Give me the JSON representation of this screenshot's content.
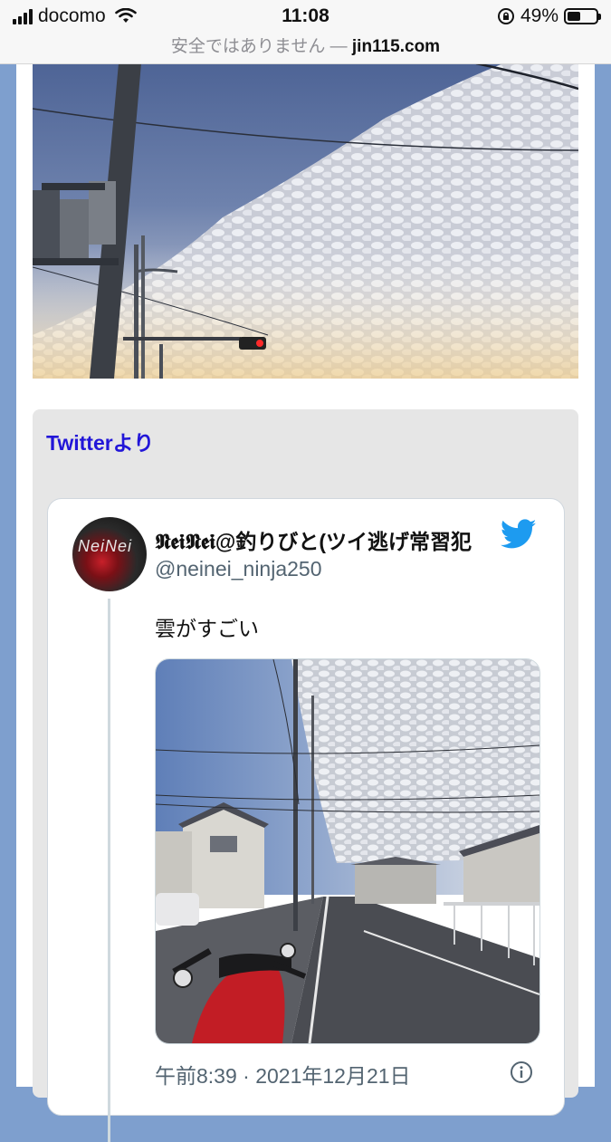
{
  "status_bar": {
    "carrier": "docomo",
    "time": "11:08",
    "battery_percent": "49%",
    "battery_level": 0.49,
    "icons": [
      "signal-bars-icon",
      "wifi-icon",
      "rotation-lock-icon",
      "battery-icon"
    ]
  },
  "browser": {
    "security_warning": "安全ではありません —",
    "host": "jin115.com"
  },
  "section": {
    "title": "Twitterより"
  },
  "tweet": {
    "display_name": "𝕹𝖊𝖎𝕹𝖊𝖎@釣りびと(ツイ逃げ常習犯",
    "handle": "@neinei_ninja250",
    "text": "雲がすごい",
    "timestamp": "午前8:39 · 2021年12月21日",
    "avatar_text": "NeiNei",
    "icons": [
      "twitter-bird-icon",
      "info-icon"
    ]
  },
  "colors": {
    "background": "#7e9fce",
    "section_title": "#2216d8",
    "twitter_blue": "#1d9bf0"
  }
}
